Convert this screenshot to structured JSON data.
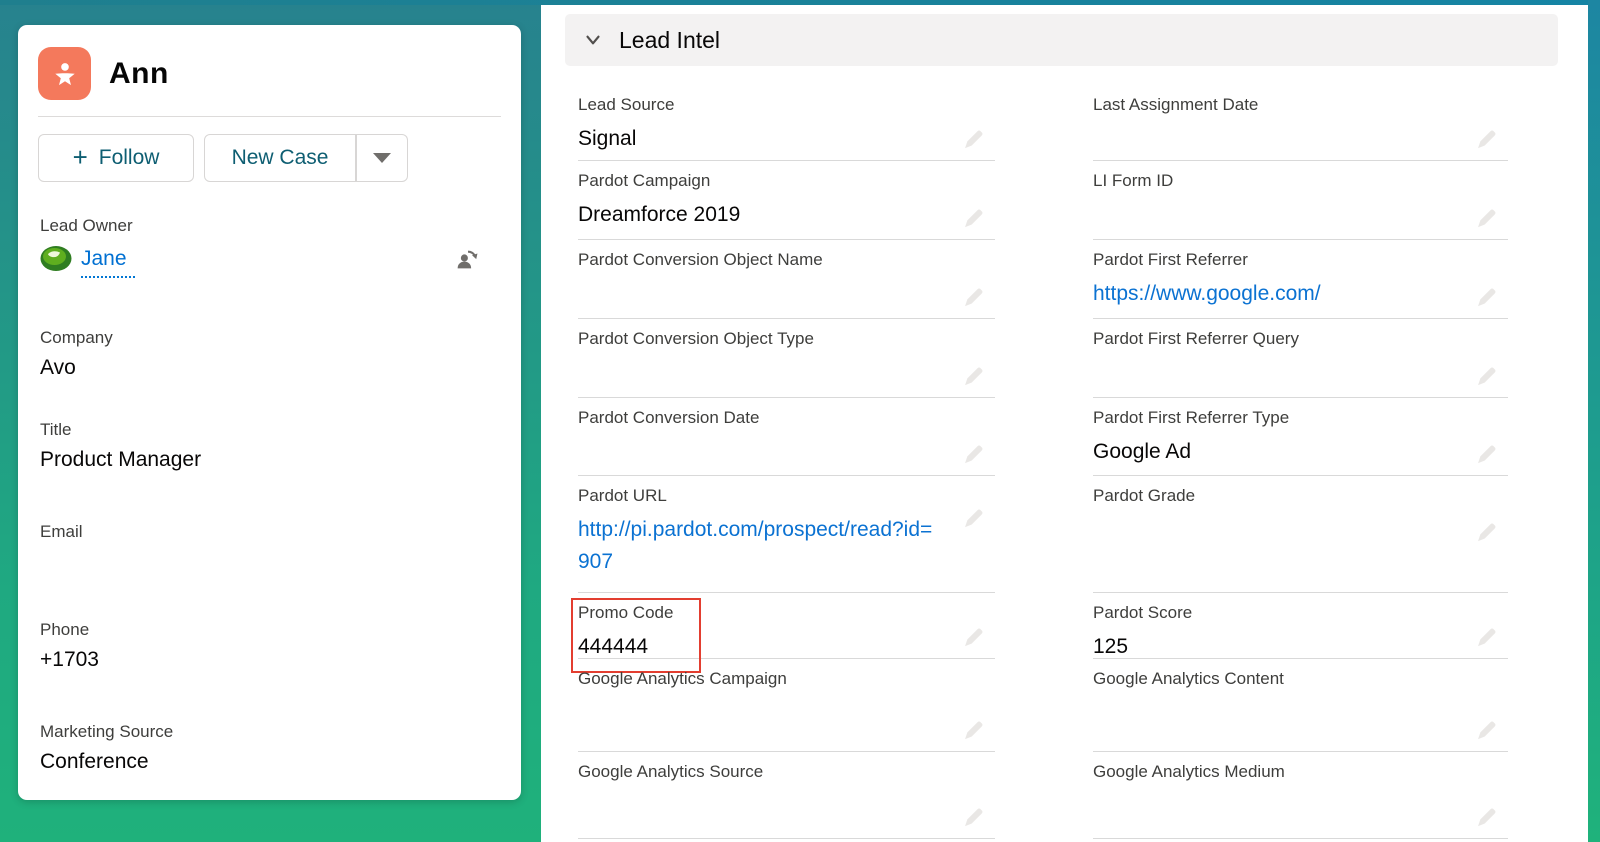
{
  "highlights_card": {
    "record_name": "Ann",
    "record_type_icon": "lead-icon",
    "follow_button": {
      "icon": "plus-icon",
      "label": "Follow"
    },
    "new_case_button": {
      "label": "New Case",
      "menu_icon": "dropdown-triangle-icon"
    },
    "fields": {
      "lead_owner": {
        "label": "Lead Owner",
        "value": "Jane",
        "avatar_icon": "avocado-avatar",
        "change_owner_icon": "change-owner-icon"
      },
      "company": {
        "label": "Company",
        "value": "Avo"
      },
      "title": {
        "label": "Title",
        "value": "Product Manager"
      },
      "email": {
        "label": "Email",
        "value": ""
      },
      "phone": {
        "label": "Phone",
        "value": "+1703"
      },
      "marketing_source": {
        "label": "Marketing Source",
        "value": "Conference"
      }
    }
  },
  "lead_intel": {
    "title": "Lead Intel",
    "collapse_icon": "chevron-down-icon",
    "edit_icon": "pencil-icon",
    "rows": [
      {
        "left": {
          "label": "Lead Source",
          "value": "Signal"
        },
        "right": {
          "label": "Last Assignment Date",
          "value": ""
        }
      },
      {
        "left": {
          "label": "Pardot Campaign",
          "value": "Dreamforce 2019"
        },
        "right": {
          "label": "LI Form ID",
          "value": ""
        }
      },
      {
        "left": {
          "label": "Pardot Conversion Object Name",
          "value": ""
        },
        "right": {
          "label": "Pardot First Referrer",
          "value": "https://www.google.com/",
          "is_link": true
        }
      },
      {
        "left": {
          "label": "Pardot Conversion Object Type",
          "value": ""
        },
        "right": {
          "label": "Pardot First Referrer Query",
          "value": ""
        }
      },
      {
        "left": {
          "label": "Pardot Conversion Date",
          "value": ""
        },
        "right": {
          "label": "Pardot First Referrer Type",
          "value": "Google Ad"
        }
      },
      {
        "left": {
          "label": "Pardot URL",
          "value": "http://pi.pardot.com/prospect/read?id=907",
          "is_link": true
        },
        "right": {
          "label": "Pardot Grade",
          "value": ""
        }
      },
      {
        "left": {
          "label": "Promo Code",
          "value": "444444",
          "annotated": true
        },
        "right": {
          "label": "Pardot Score",
          "value": "125"
        }
      },
      {
        "left": {
          "label": "Google Analytics Campaign",
          "value": ""
        },
        "right": {
          "label": "Google Analytics Content",
          "value": ""
        }
      },
      {
        "left": {
          "label": "Google Analytics Source",
          "value": ""
        },
        "right": {
          "label": "Google Analytics Medium",
          "value": ""
        }
      }
    ]
  },
  "colors": {
    "gradient_top_teal": "#27828e",
    "gradient_bottom_green": "#1fb17b",
    "top_strip_teal": "#1584a4",
    "lead_icon_orange": "#f4795c",
    "button_text_teal": "#0e5e72",
    "link_blue": "#0b72d2",
    "annotation_red": "#e33e30",
    "label_gray": "#3e3e3c",
    "value_black": "#080707"
  }
}
